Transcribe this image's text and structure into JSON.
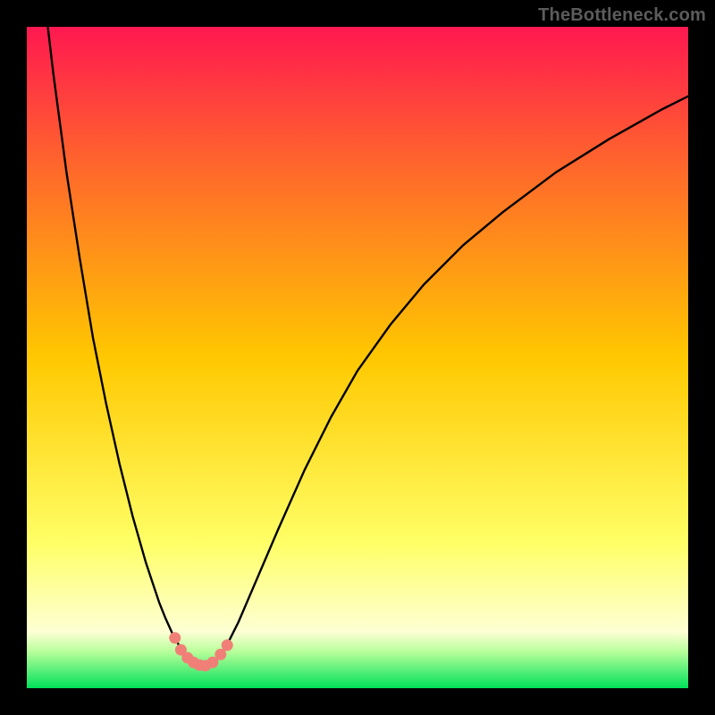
{
  "watermark": "TheBottleneck.com",
  "colors": {
    "background": "#000000",
    "gradient_top": "#ff1850",
    "gradient_mid_upper": "#ff6a2a",
    "gradient_mid": "#ffc800",
    "gradient_lower": "#ffff66",
    "gradient_pale": "#fdffd4",
    "gradient_green_top": "#b7ff9a",
    "gradient_green": "#00e05a",
    "curve": "#000000",
    "marker_fill": "#f08077",
    "marker_stroke": "#c84444"
  },
  "chart_data": {
    "type": "line",
    "title": "",
    "xlabel": "",
    "ylabel": "",
    "xlim": [
      0,
      100
    ],
    "ylim": [
      0,
      100
    ],
    "series": [
      {
        "name": "bottleneck-curve",
        "x": [
          0,
          2,
          4,
          6,
          8,
          10,
          12,
          14,
          16,
          18,
          19,
          20,
          21,
          22,
          23,
          24,
          25,
          26,
          27,
          28,
          29,
          30,
          32,
          35,
          38,
          42,
          46,
          50,
          55,
          60,
          66,
          72,
          80,
          88,
          96,
          100
        ],
        "values": [
          130,
          110,
          93,
          78,
          65,
          53,
          43,
          34,
          26,
          19,
          16,
          13,
          10.5,
          8.3,
          6.5,
          5.0,
          4.0,
          3.4,
          3.2,
          3.6,
          4.6,
          6.0,
          10,
          17,
          24,
          33,
          41,
          48,
          55,
          61,
          67,
          72,
          78,
          83,
          87.5,
          89.5
        ]
      }
    ],
    "markers": {
      "name": "optimal-range-markers",
      "x": [
        22.4,
        23.3,
        24.3,
        25.2,
        26.1,
        27.0,
        28.1,
        29.3,
        30.3
      ],
      "y": [
        7.6,
        5.8,
        4.6,
        3.9,
        3.5,
        3.4,
        3.9,
        5.1,
        6.5
      ]
    },
    "gradient_stops": [
      {
        "offset": 0.0,
        "key": "gradient_top"
      },
      {
        "offset": 0.22,
        "key": "gradient_mid_upper"
      },
      {
        "offset": 0.5,
        "key": "gradient_mid"
      },
      {
        "offset": 0.78,
        "key": "gradient_lower"
      },
      {
        "offset": 0.915,
        "key": "gradient_pale"
      },
      {
        "offset": 0.945,
        "key": "gradient_green_top"
      },
      {
        "offset": 1.0,
        "key": "gradient_green"
      }
    ]
  }
}
